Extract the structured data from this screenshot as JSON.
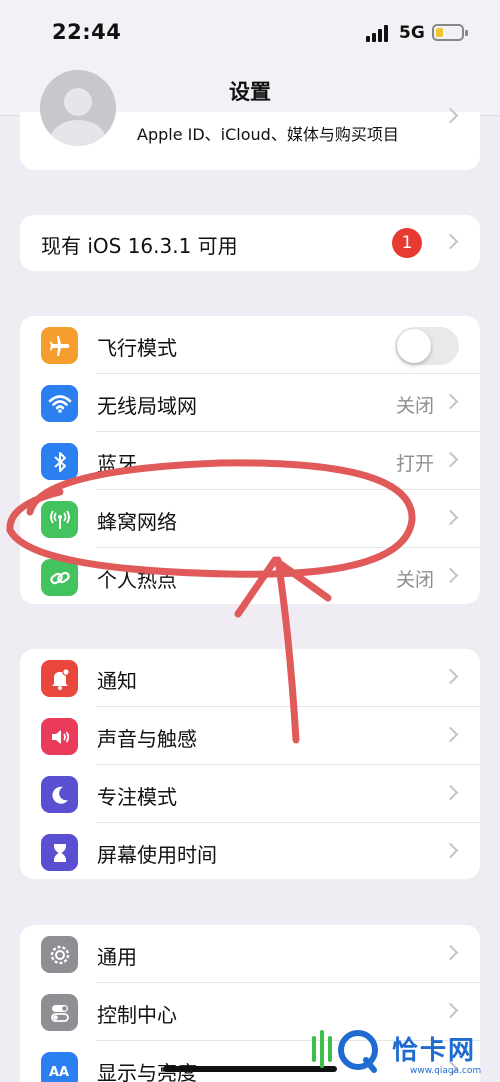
{
  "status_bar": {
    "time": "22:44",
    "network": "5G",
    "battery_level": 0.25
  },
  "nav": {
    "title": "设置"
  },
  "profile": {
    "subtitle": "Apple ID、iCloud、媒体与购买项目"
  },
  "update": {
    "label": "现有 iOS 16.3.1 可用",
    "badge": "1"
  },
  "group1": [
    {
      "label": "飞行模式",
      "icon": "airplane-icon",
      "color": "#f59d2d",
      "toggle": false
    },
    {
      "label": "无线局域网",
      "icon": "wifi-icon",
      "color": "#2c7ff0",
      "value": "关闭"
    },
    {
      "label": "蓝牙",
      "icon": "bluetooth-icon",
      "color": "#2c7ff0",
      "value": "打开"
    },
    {
      "label": "蜂窝网络",
      "icon": "cellular-icon",
      "color": "#43c35e",
      "value": ""
    },
    {
      "label": "个人热点",
      "icon": "hotspot-icon",
      "color": "#43c35e",
      "value": "关闭"
    }
  ],
  "group2": [
    {
      "label": "通知",
      "icon": "notification-icon",
      "color": "#e9463d"
    },
    {
      "label": "声音与触感",
      "icon": "sound-icon",
      "color": "#ea3b5a"
    },
    {
      "label": "专注模式",
      "icon": "moon-icon",
      "color": "#5a4fd0"
    },
    {
      "label": "屏幕使用时间",
      "icon": "hourglass-icon",
      "color": "#5a4fd0"
    }
  ],
  "group3": [
    {
      "label": "通用",
      "icon": "gear-icon",
      "color": "#8e8e93"
    },
    {
      "label": "控制中心",
      "icon": "toggles-icon",
      "color": "#8e8e93"
    },
    {
      "label": "显示与亮度",
      "icon": "display-icon",
      "color": "#2c7ff0"
    }
  ],
  "watermark": {
    "text": "恰卡网",
    "url": "www.qiaqa.com"
  },
  "annotation": {
    "color": "#e05a5a"
  }
}
